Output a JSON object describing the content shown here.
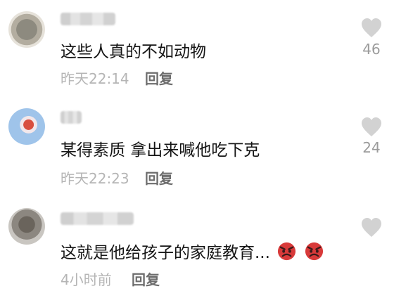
{
  "comments": [
    {
      "text": "这些人真的不如动物",
      "time": "昨天22:14",
      "reply": "回复",
      "likes": "46",
      "avatar_icon": "avatar-image",
      "like_icon": "heart-icon"
    },
    {
      "text": "某得素质 拿出来喊他吃下克",
      "time": "昨天22:23",
      "reply": "回复",
      "likes": "24",
      "avatar_icon": "avatar-image",
      "like_icon": "heart-icon"
    },
    {
      "text": "这就是他给孩子的家庭教育...",
      "time": "4小时前",
      "reply": "回复",
      "likes": "",
      "avatar_icon": "avatar-image",
      "like_icon": "heart-icon",
      "trailing_emojis": [
        "angry-face-icon",
        "angry-face-icon"
      ]
    }
  ],
  "colors": {
    "text": "#151515",
    "time": "#b5b5b5",
    "reply": "#6d6d6d",
    "heart": "#d2d2d2",
    "emoji": "#d83a3a"
  }
}
